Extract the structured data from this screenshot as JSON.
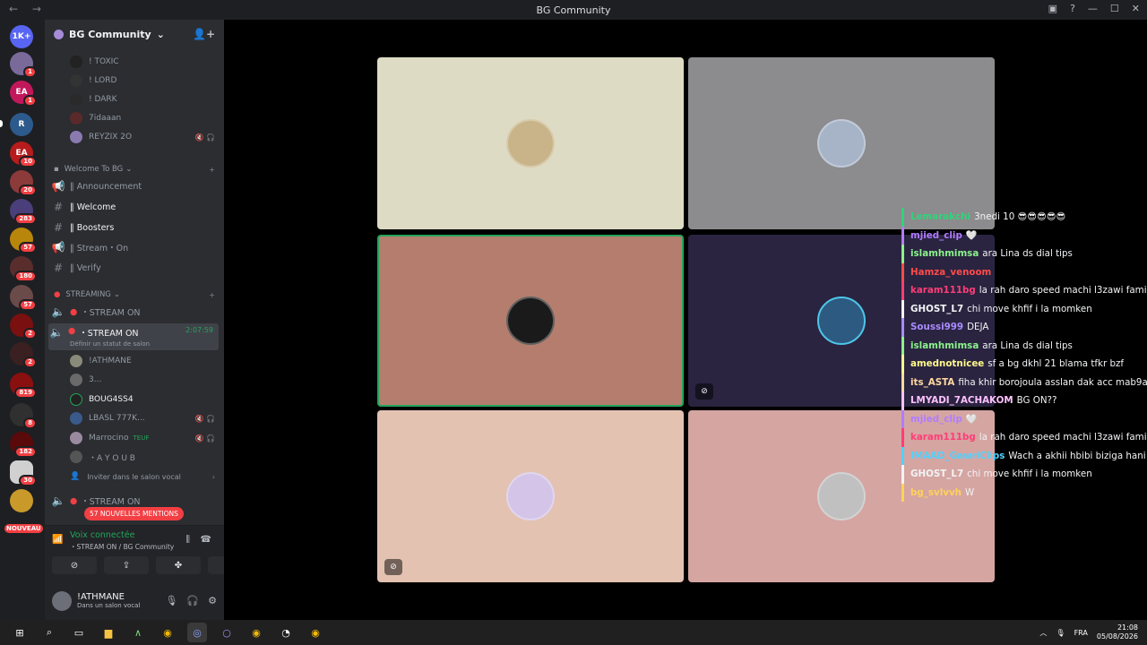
{
  "window": {
    "title": "BG Community",
    "nav": "← →"
  },
  "servers": [
    {
      "label": "1K+",
      "badge": ""
    },
    {
      "label": "",
      "badge": "1"
    },
    {
      "label": "EA",
      "badge": "1"
    },
    {
      "label": "R",
      "badge": ""
    },
    {
      "label": "EA",
      "badge": "10"
    },
    {
      "label": "",
      "badge": "20"
    },
    {
      "label": "",
      "badge": "283"
    },
    {
      "label": "",
      "badge": "57"
    },
    {
      "label": "",
      "badge": "180"
    },
    {
      "label": "",
      "badge": "57"
    },
    {
      "label": "",
      "badge": "2"
    },
    {
      "label": "",
      "badge": "2"
    },
    {
      "label": "",
      "badge": "819"
    },
    {
      "label": "",
      "badge": "8"
    },
    {
      "label": "",
      "badge": "182"
    },
    {
      "label": "",
      "badge": "30"
    }
  ],
  "nouveau": "NOUVEAU",
  "guild": {
    "name": "BG Community"
  },
  "members_top": [
    "! TOXIC",
    "! LORD",
    "! DARK",
    "7idaaan",
    "REYZIX 2O"
  ],
  "cat_welcome": "Welcome To BG",
  "channels": [
    {
      "icon": "📢",
      "name": "‖ Announcement"
    },
    {
      "icon": "#",
      "name": "‖ Welcome"
    },
    {
      "icon": "#",
      "name": "‖ Boosters"
    },
    {
      "icon": "📢",
      "name": "‖ Stream・On"
    },
    {
      "icon": "#",
      "name": "‖ Verify"
    }
  ],
  "cat_streaming": "STREAMING",
  "voice1": "・STREAM ON",
  "voice2": {
    "name": "・STREAM ON",
    "timer": "2:07:59",
    "status": "Définir un statut de salon"
  },
  "voice_members": [
    "!ATHMANE",
    "3...",
    "BOUG4SS4",
    "LBASL 777K...",
    "Marrocino",
    "・A Y O U B"
  ],
  "tag": "TEUF",
  "invite": "Inviter dans le salon vocal",
  "voice3": "・STREAM ON",
  "mentions": "57 NOUVELLES MENTIONS",
  "voicebar": {
    "status": "Voix connectée",
    "where": "・STREAM ON / BG Community"
  },
  "user": {
    "name": "!ATHMANE",
    "status": "Dans un salon vocal"
  },
  "chat": [
    {
      "user": "Lemarakchi",
      "color": "#2fd47a",
      "text": "3nedi 10 😎😎😎😎😎"
    },
    {
      "user": "mjied_clip",
      "color": "#b07cff",
      "text": "🤍"
    },
    {
      "user": "islamhmimsa",
      "color": "#8cf28c",
      "text": "ara Lina ds dial tips"
    },
    {
      "user": "Hamza_venoom",
      "color": "#ff4b4b",
      "text": ""
    },
    {
      "user": "karam111bg",
      "color": "#ff3d77",
      "text": "la rah daro speed machi l3zawi family"
    },
    {
      "user": "GHOST_L7",
      "color": "#f2f3f5",
      "text": "chi move khfif i la momken"
    },
    {
      "user": "Soussi999",
      "color": "#a98bff",
      "text": "DEJA"
    },
    {
      "user": "islamhmimsa",
      "color": "#8cf28c",
      "text": "ara Lina ds dial tips"
    },
    {
      "user": "amednotnicee",
      "color": "#fff88c",
      "text": "sf a bg dkhl 21 blama tfkr bzf"
    },
    {
      "user": "its_ASTA",
      "color": "#ffd9a0",
      "text": "fiha khir borojoula asslan dak acc mab9a kijil"
    },
    {
      "user": "LMYADI_7ACHAKOM",
      "color": "#ffc0ff",
      "text": "BG ON??"
    },
    {
      "user": "mjied_clip",
      "color": "#b07cff",
      "text": "🤍"
    },
    {
      "user": "karam111bg",
      "color": "#ff3d77",
      "text": "la rah daro speed machi l3zawi family"
    },
    {
      "user": "IMAAD_GawriClips",
      "color": "#4fd2ff",
      "text": "Wach a akhii hbibi biziga hani lya h"
    },
    {
      "user": "GHOST_L7",
      "color": "#f2f3f5",
      "text": "chi move khfif i la momken"
    },
    {
      "user": "bg_svlvvh",
      "color": "#ffd25a",
      "text": "W"
    }
  ],
  "taskbar": {
    "lang": "FRA",
    "time": "21:08",
    "date": "05/08/2026"
  }
}
